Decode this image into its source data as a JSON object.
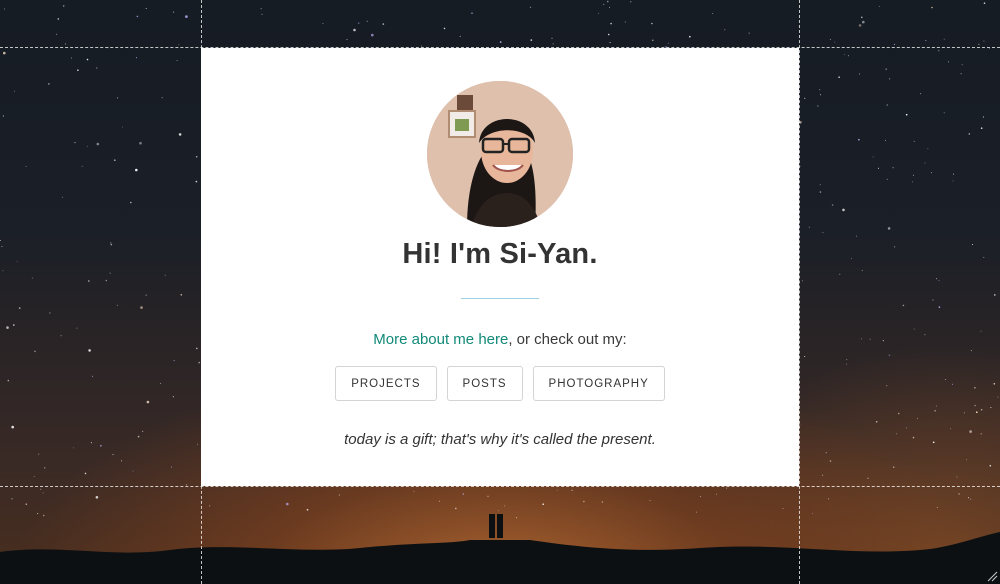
{
  "page": {
    "heading": "Hi! I'm Si-Yan.",
    "intro_link": "More about me here",
    "intro_rest": ", or check out my:",
    "buttons": {
      "projects": "PROJECTS",
      "posts": "POSTS",
      "photography": "PHOTOGRAPHY"
    },
    "quote": "today is a gift; that's why it's called the present."
  },
  "colors": {
    "link": "#128a78",
    "divider": "#9fd3e3",
    "heading": "#333333",
    "card": "#ffffff"
  },
  "icons": {
    "resize_grip": "resize-grip-icon"
  }
}
